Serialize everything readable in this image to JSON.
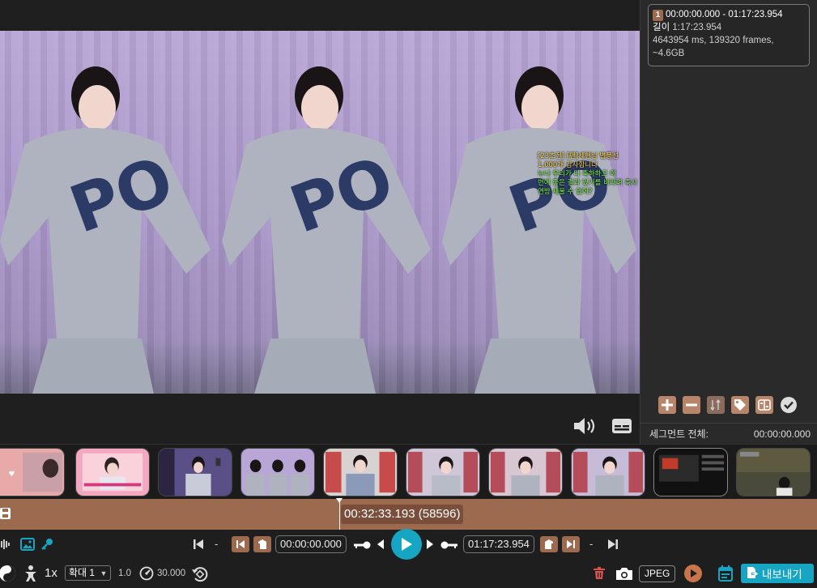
{
  "segment": {
    "number": "1",
    "range": "00:00:00.000 - 01:17:23.954",
    "length_label": "길이",
    "length_value": "1:17:23.954",
    "stats": "4643954 ms, 139320 frames,",
    "size": "~4.6GB"
  },
  "segment_footer": {
    "label": "세그먼트 전체:",
    "value": "00:00:00.000"
  },
  "overlay_chat": {
    "line1": "[23초전] [팬]세현님 별풍선",
    "line2": "1,000개 감사합니다",
    "line3": "누나 우리가 다 축하하고 이",
    "line4": "번에 좋은 결과 있기를 바라며 축시",
    "line5": "연방 새울 수 있어?"
  },
  "timeline": {
    "current": "00:32:33.193 (58596)"
  },
  "transport": {
    "start_time": "00:00:00.000",
    "end_time": "01:17:23.954",
    "dash": "-"
  },
  "bottom": {
    "speed": "1x",
    "zoom_select": "확대 1",
    "zoom_value": "1.0",
    "fps": "30.000",
    "format": "JPEG",
    "export_label": "내보내기"
  },
  "colors": {
    "accent": "#16a5c2",
    "timeline": "#9b6a4f",
    "segment_button": "#b9856a"
  }
}
